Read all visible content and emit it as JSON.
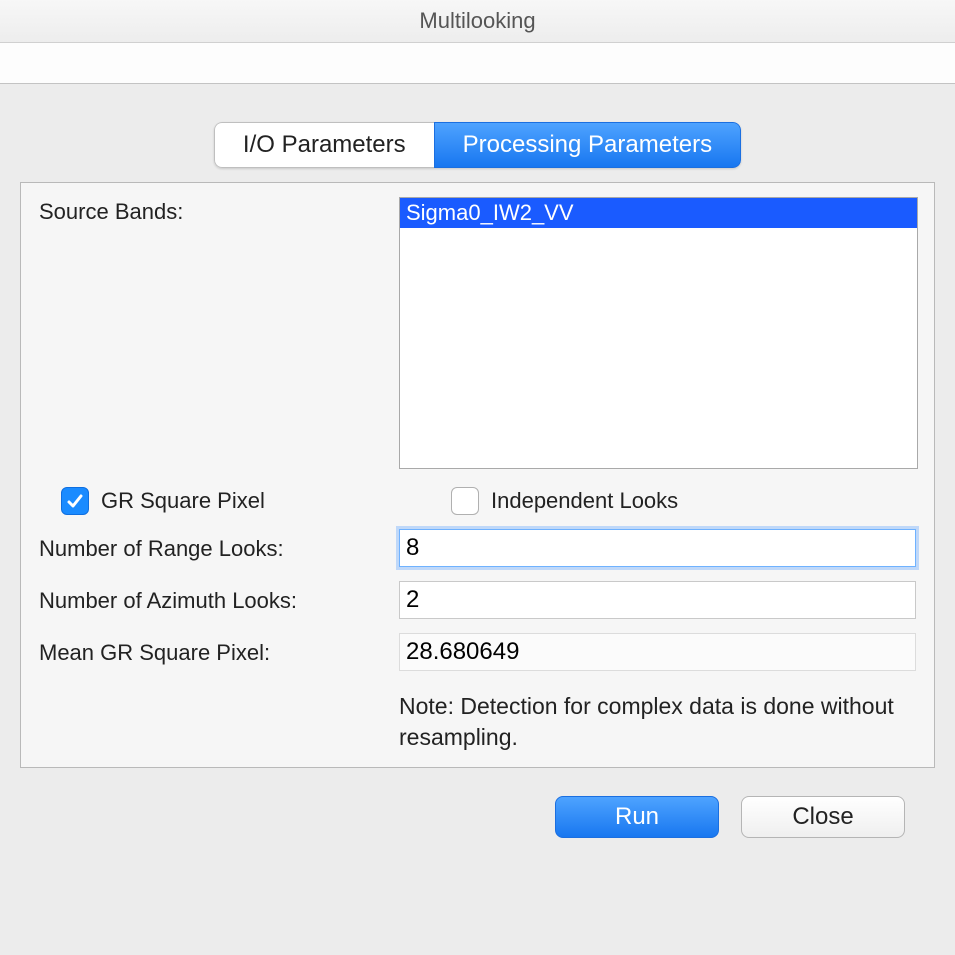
{
  "window": {
    "title": "Multilooking"
  },
  "tabs": {
    "io": "I/O Parameters",
    "processing": "Processing Parameters",
    "active": "processing"
  },
  "form": {
    "source_bands_label": "Source Bands:",
    "source_bands": {
      "items": [
        {
          "label": "Sigma0_IW2_VV",
          "selected": true
        }
      ]
    },
    "gr_square_pixel": {
      "label": "GR Square Pixel",
      "checked": true
    },
    "independent_looks": {
      "label": "Independent Looks",
      "checked": false
    },
    "range_looks": {
      "label": "Number of Range Looks:",
      "value": "8"
    },
    "azimuth_looks": {
      "label": "Number of Azimuth Looks:",
      "value": "2"
    },
    "mean_gr": {
      "label": "Mean GR Square Pixel:",
      "value": "28.680649"
    },
    "note": "Note: Detection for complex data is done without resampling."
  },
  "buttons": {
    "run": "Run",
    "close": "Close"
  }
}
